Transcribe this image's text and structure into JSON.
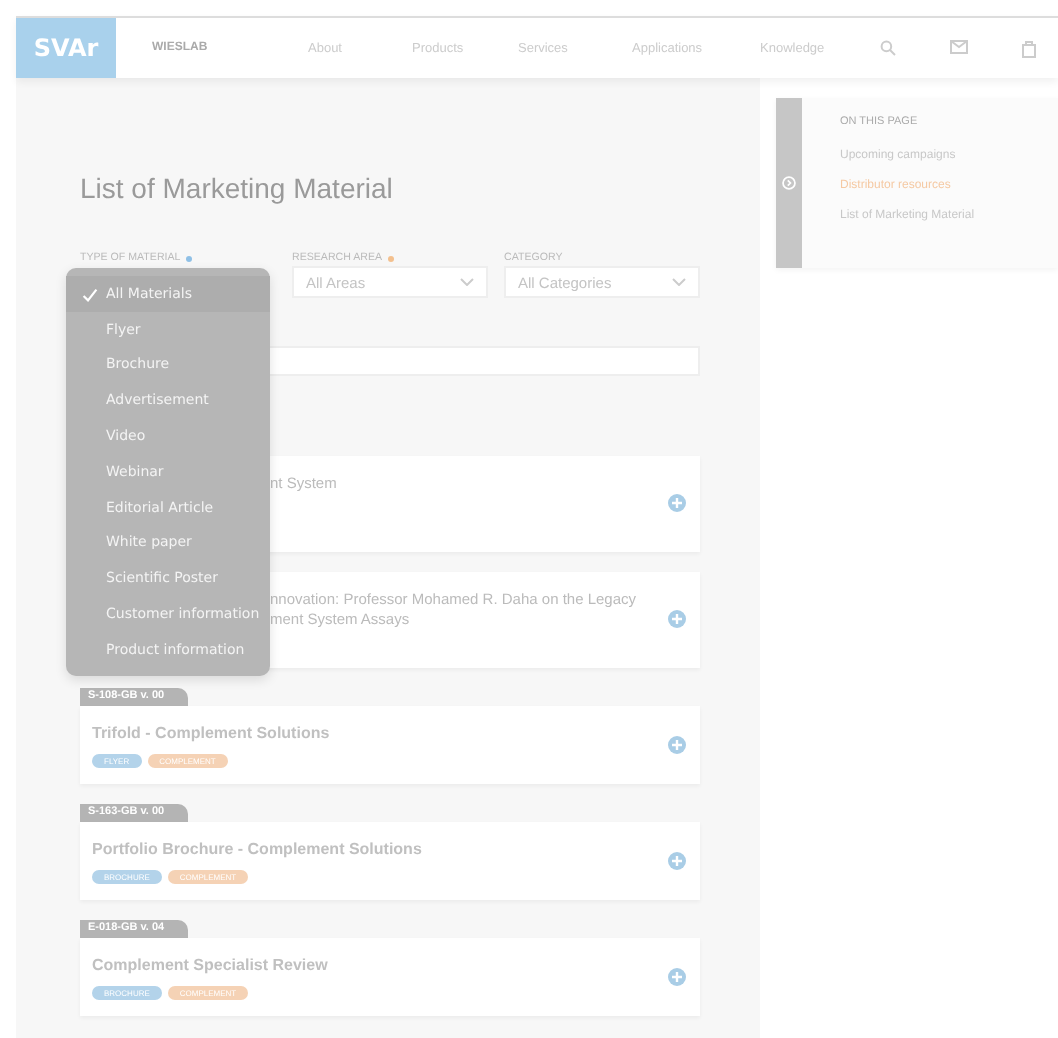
{
  "nav": {
    "logo": "SVAr",
    "brand": "WIESLAB",
    "links": [
      "About",
      "Products",
      "Services",
      "Applications",
      "Knowledge"
    ]
  },
  "page_title": "List of Marketing Material",
  "filters": [
    {
      "label": "TYPE OF MATERIAL",
      "color": "#8fc0e6"
    },
    {
      "label": "RESEARCH AREA",
      "color": "#f3c08e",
      "value": "All Areas"
    },
    {
      "label": "CATEGORY",
      "value": "All Categories"
    }
  ],
  "dropdown": [
    {
      "label": "All Materials",
      "selected": true
    },
    {
      "label": "Flyer",
      "selected": false
    },
    {
      "label": "Brochure",
      "selected": false
    },
    {
      "label": "Advertisement",
      "selected": false
    },
    {
      "label": "Video",
      "selected": false
    },
    {
      "label": "Webinar",
      "selected": false
    },
    {
      "label": "Editorial Article",
      "selected": false
    },
    {
      "label": "White paper",
      "selected": false
    },
    {
      "label": "Scientific Poster",
      "selected": false
    },
    {
      "label": "Customer information",
      "selected": false
    },
    {
      "label": "Product information",
      "selected": false
    }
  ],
  "materials": [
    {
      "title_lines": [
        "nt System"
      ],
      "partly_hidden": true
    },
    {
      "title_lines": [
        "nnovation: Professor Mohamed R. Daha on the Legacy",
        "ment System Assays"
      ],
      "partly_hidden": true
    },
    {
      "code": "S-108-GB v. 00",
      "title_lines": [
        "Trifold - Complement Solutions"
      ],
      "tags": [
        {
          "label": "FLYER",
          "color": "#b3d3ea"
        },
        {
          "label": "COMPLEMENT",
          "color": "#f5d2b5"
        }
      ]
    },
    {
      "code": "S-163-GB v. 00",
      "title_lines": [
        "Portfolio Brochure - Complement Solutions"
      ],
      "tags": [
        {
          "label": "BROCHURE",
          "color": "#b3d3ea"
        },
        {
          "label": "COMPLEMENT",
          "color": "#f5d2b5"
        }
      ]
    },
    {
      "code": "E-018-GB v. 04",
      "title_lines": [
        "Complement Specialist Review"
      ],
      "tags": [
        {
          "label": "BROCHURE",
          "color": "#b3d3ea"
        },
        {
          "label": "COMPLEMENT",
          "color": "#f5d2b5"
        }
      ]
    }
  ],
  "on_this_page": {
    "heading": "ON THIS PAGE",
    "links": [
      {
        "label": "Upcoming campaigns",
        "selected": false
      },
      {
        "label": "Distributor resources",
        "selected": true
      },
      {
        "label": "List of Marketing Material",
        "selected": false
      }
    ]
  }
}
